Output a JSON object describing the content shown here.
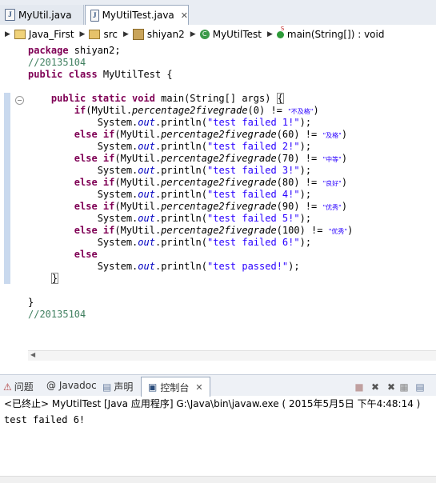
{
  "editor_tabs": [
    {
      "label": "MyUtil.java",
      "active": false
    },
    {
      "label": "MyUtilTest.java",
      "active": true
    }
  ],
  "tab_close": "✕",
  "breadcrumb": {
    "project": "Java_First",
    "folder": "src",
    "package": "shiyan2",
    "class": "MyUtilTest",
    "method": "main(String[]) : void"
  },
  "code": {
    "l1_kw": "package",
    "l1_rest": " shiyan2;",
    "l2_comment": "//20135104",
    "l3_kw": "public class",
    "l3_rest": " MyUtilTest {",
    "l4_kw": "public static void",
    "l4_rest": " main(String[] args) ",
    "l4_brace": "{",
    "if_kw": "if",
    "else_if_kw": "else if",
    "else_kw": "else",
    "call_prefix": "(MyUtil.",
    "method_name": "percentage2fivegrade",
    "system": "System.",
    "out": "out",
    "println": ".println(",
    "close_paren": ");",
    "checks": [
      {
        "arg": "(0) != ",
        "str": "\"不及格\"",
        "msg": "\"test failed 1!\""
      },
      {
        "arg": "(60) != ",
        "str": "\"及格\"",
        "msg": "\"test failed 2!\""
      },
      {
        "arg": "(70) != ",
        "str": "\"中等\"",
        "msg": "\"test failed 3!\""
      },
      {
        "arg": "(80) != ",
        "str": "\"良好\"",
        "msg": "\"test failed 4!\""
      },
      {
        "arg": "(90) != ",
        "str": "\"优秀\"",
        "msg": "\"test failed 5!\""
      },
      {
        "arg": "(100) != ",
        "str": "\"优秀\"",
        "msg": "\"test failed 6!\""
      }
    ],
    "cond_close": ")",
    "passed_msg": "\"test passed!\"",
    "method_close": "}",
    "class_close": "}",
    "end_comment": "//20135104"
  },
  "console": {
    "tabs": [
      "问题",
      "@ Javadoc",
      "声明",
      "控制台"
    ],
    "tab_close": "✕",
    "status": "<已终止> MyUtilTest [Java 应用程序] G:\\Java\\bin\\javaw.exe ( 2015年5月5日 下午4:48:14 )",
    "output": "test failed 6!"
  },
  "colors": {
    "keyword": "#7f0055",
    "comment": "#3f7f5f",
    "string": "#2a00ff",
    "field": "#0000c0"
  }
}
